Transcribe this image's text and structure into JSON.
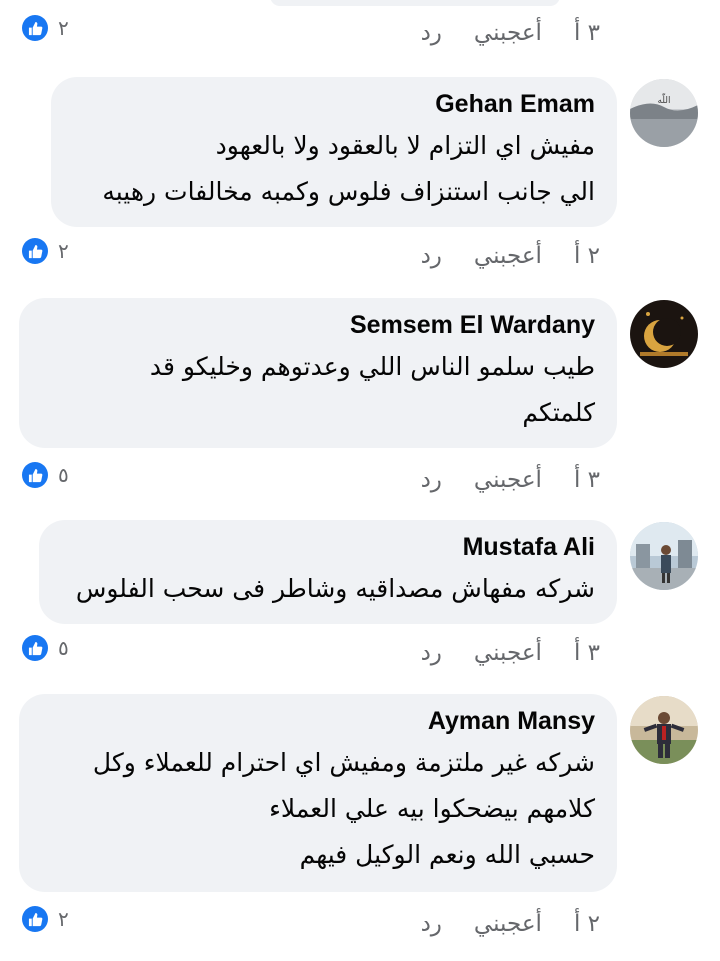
{
  "colors": {
    "accent": "#1877f2",
    "bubble": "#f0f2f5",
    "meta_text": "#65676b"
  },
  "top_meta": {
    "like_count": "٢",
    "time": "٣ أ",
    "like_label": "أعجبني",
    "reply_label": "رد"
  },
  "comments": [
    {
      "name": "Gehan Emam",
      "text": "مفيش اي التزام لا بالعقود ولا بالعهود\nالي جانب استنزاف فلوس وكمبه مخالفات رهيبه",
      "like_count": "٢",
      "time": "٢ أ",
      "like_label": "أعجبني",
      "reply_label": "رد",
      "avatar_icon": "landscape-avatar"
    },
    {
      "name": "Semsem El Wardany",
      "text": "طيب سلمو الناس اللي وعدتوهم وخليكو قد\nكلمتكم",
      "like_count": "٥",
      "time": "٣ أ",
      "like_label": "أعجبني",
      "reply_label": "رد",
      "avatar_icon": "crescent-avatar"
    },
    {
      "name": "Mustafa Ali",
      "text": "شركه مفهاش مصداقيه وشاطر فى سحب الفلوس",
      "like_count": "٥",
      "time": "٣ أ",
      "like_label": "أعجبني",
      "reply_label": "رد",
      "avatar_icon": "person-photo-avatar"
    },
    {
      "name": "Ayman Mansy",
      "text": "شركه غير ملتزمة ومفيش اي احترام للعملاء وكل\nكلامهم بيضحكوا بيه علي العملاء\nحسبي الله ونعم الوكيل فيهم",
      "like_count": "٢",
      "time": "٢ أ",
      "like_label": "أعجبني",
      "reply_label": "رد",
      "avatar_icon": "person-photo-avatar"
    }
  ]
}
